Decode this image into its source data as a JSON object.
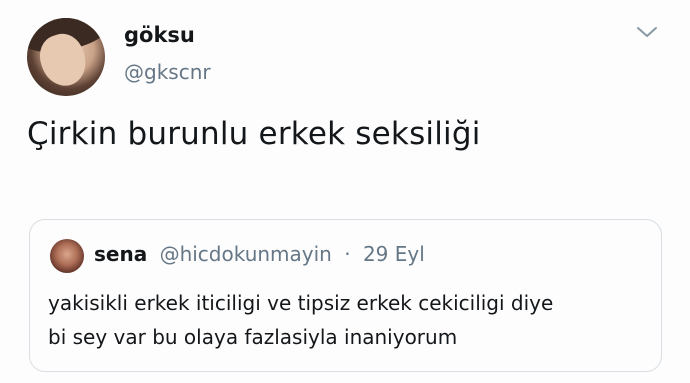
{
  "author": {
    "display_name": "göksu",
    "handle": "@gkscnr"
  },
  "tweet": {
    "text": "Çirkin burunlu erkek seksiliği"
  },
  "quoted_tweet": {
    "display_name": "sena",
    "handle": "@hicdokunmayin",
    "separator": "·",
    "date": "29 Eyl",
    "text_line1": "yakisikli erkek iticiligi ve tipsiz erkek cekiciligi diye",
    "text_line2": "bi sey var bu olaya fazlasiyla inaniyorum"
  },
  "icons": {
    "menu": "chevron-down-icon"
  },
  "colors": {
    "text_primary": "#14171a",
    "text_secondary": "#657786",
    "border": "#d8dee3",
    "background": "#fdfdfd"
  }
}
